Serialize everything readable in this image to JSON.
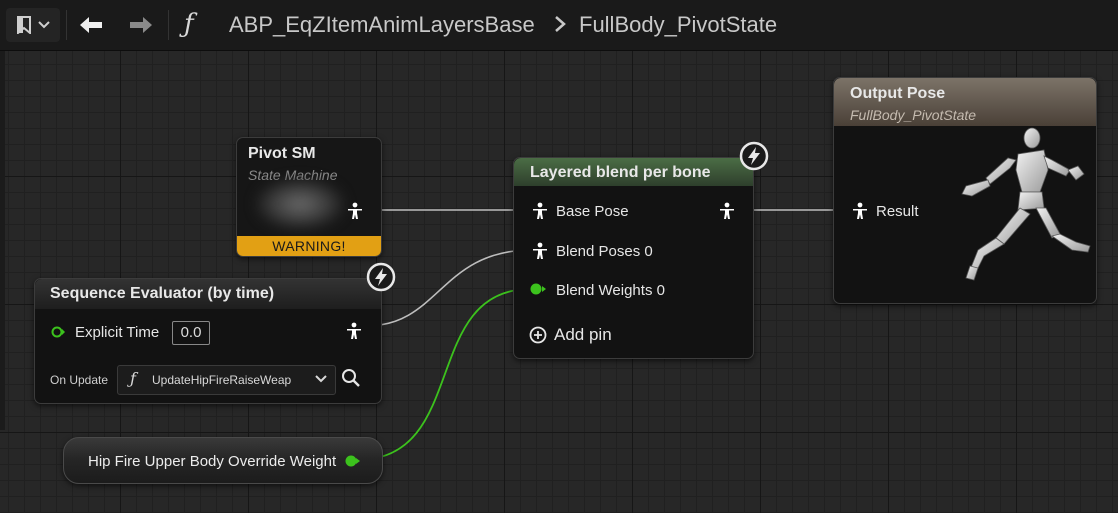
{
  "topbar": {
    "bookmark_icon": "bookmark-icon",
    "back_icon": "arrow-left-icon",
    "forward_icon": "arrow-right-icon",
    "function_icon": "function-icon",
    "function_glyph": "ƒ",
    "breadcrumb": [
      "ABP_EqZItemAnimLayersBase",
      "FullBody_PivotState"
    ]
  },
  "nodes": {
    "pivot_sm": {
      "title": "Pivot SM",
      "subtitle": "State Machine",
      "warning": "WARNING!"
    },
    "sequence_evaluator": {
      "title": "Sequence Evaluator (by time)",
      "explicit_time_label": "Explicit Time",
      "explicit_time_value": "0.0",
      "on_update_label": "On Update",
      "on_update_glyph": "ƒ",
      "on_update_value": "UpdateHipFireRaiseWeap"
    },
    "layered_blend": {
      "title": "Layered blend per bone",
      "pins": [
        "Base Pose",
        "Blend Poses 0",
        "Blend Weights 0"
      ],
      "add_pin": "Add pin"
    },
    "output_pose": {
      "title": "Output Pose",
      "subtitle": "FullBody_PivotState",
      "result_label": "Result"
    },
    "variable": {
      "label": "Hip Fire Upper Body Override Weight"
    }
  },
  "colors": {
    "warning": "#e2a014",
    "float_pin": "#3cc21d",
    "blend_header": "#4b6d45",
    "output_header": "#7c7368",
    "pose_wire": "#c8c8c8"
  }
}
